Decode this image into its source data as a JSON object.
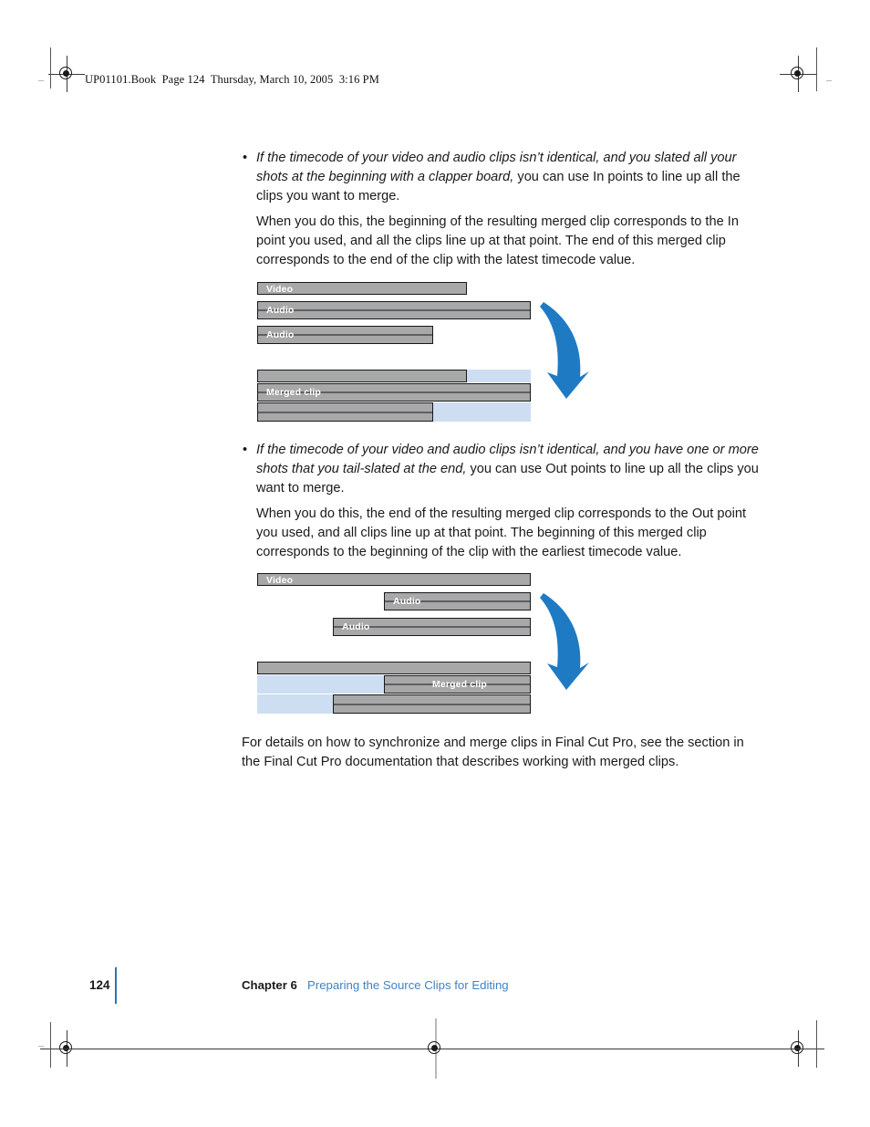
{
  "page": {
    "slug": "UP01101.Book  Page 124  Thursday, March 10, 2005  3:16 PM",
    "bullet_marker": "•"
  },
  "body": {
    "bullet1": {
      "emphasis": "If the timecode of your video and audio clips isn’t identical, and you slated all your shots at the beginning with a clapper board,",
      "rest": " you can use In points to line up all the clips you want to merge.",
      "paragraph": "When you do this, the beginning of the resulting merged clip corresponds to the In point you used, and all the clips line up at that point. The end of this merged clip corresponds to the end of the clip with the latest timecode value."
    },
    "bullet2": {
      "emphasis": "If the timecode of your video and audio clips isn’t identical, and you have one or more shots that you tail-slated at the end,",
      "rest": " you can use Out points to line up all the clips you want to merge.",
      "paragraph": "When you do this, the end of the resulting merged clip corresponds to the Out point you used, and all clips line up at that point. The beginning of this merged clip corresponds to the beginning of the clip with the earliest timecode value."
    },
    "closing": "For details on how to synchronize and merge clips in Final Cut Pro, see the section in the Final Cut Pro documentation that describes working with merged clips."
  },
  "diagram1": {
    "labels": {
      "video": "Video",
      "audio1": "Audio",
      "audio2": "Audio",
      "merged": "Merged clip"
    }
  },
  "diagram2": {
    "labels": {
      "video": "Video",
      "audio1": "Audio",
      "audio2": "Audio",
      "merged": "Merged clip"
    }
  },
  "footer": {
    "page_number": "124",
    "chapter": "Chapter 6",
    "chapter_title": "Preparing the Source Clips for Editing"
  },
  "colors": {
    "clip_gray": "#a8a8a8",
    "clip_blue": "#cedef2",
    "arrow_blue": "#1f7ac4",
    "link_blue": "#3f83c4",
    "rule_blue": "#2b74b8"
  }
}
